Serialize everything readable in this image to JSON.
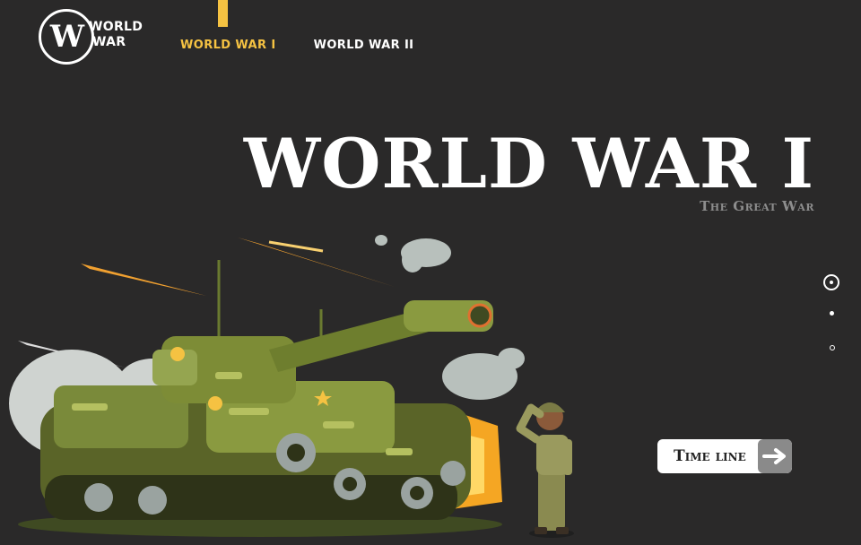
{
  "logo": {
    "letter": "W",
    "line1": "WORLD",
    "line2": "WAR"
  },
  "nav": {
    "items": [
      {
        "label": "WORLD WAR I",
        "active": true
      },
      {
        "label": "WORLD WAR II",
        "active": false
      }
    ]
  },
  "hero": {
    "title": "WORLD WAR I",
    "subtitle": "The Great War"
  },
  "timeline_button": {
    "label": "Time line",
    "icon": "arrow-right-icon"
  },
  "colors": {
    "background": "#2a2929",
    "accent": "#f5c242",
    "subtitle": "#8d8d8d",
    "button_icon_bg": "#8a8a8a"
  },
  "pagination": {
    "count": 3,
    "active_index": 1
  }
}
